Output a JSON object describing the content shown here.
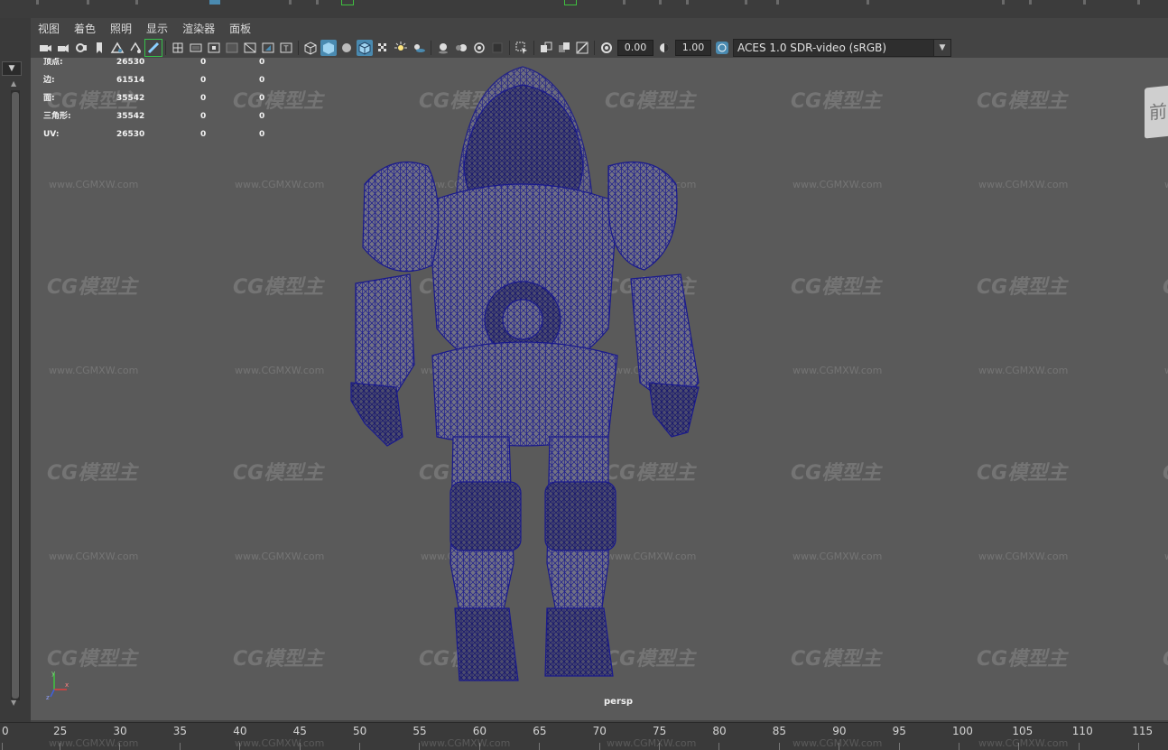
{
  "menu": [
    "视图",
    "着色",
    "照明",
    "显示",
    "渲染器",
    "面板"
  ],
  "toolbar": {
    "exposure": "0.00",
    "gamma": "1.00",
    "color_space": "ACES 1.0 SDR-video (sRGB)"
  },
  "hud": {
    "rows": [
      {
        "label": "顶点:",
        "v1": "26530",
        "v2": "0",
        "v3": "0"
      },
      {
        "label": "边:",
        "v1": "61514",
        "v2": "0",
        "v3": "0"
      },
      {
        "label": "面:",
        "v1": "35542",
        "v2": "0",
        "v3": "0"
      },
      {
        "label": "三角形:",
        "v1": "35542",
        "v2": "0",
        "v3": "0"
      },
      {
        "label": "UV:",
        "v1": "26530",
        "v2": "0",
        "v3": "0"
      }
    ]
  },
  "camera_label": "persp",
  "viewcube_face": "前",
  "axis_labels": {
    "y": "y",
    "x": "x",
    "z": "z"
  },
  "watermark": {
    "logo": "CG模型主",
    "url": "www.CGMXW.com"
  },
  "timeline": {
    "ticks": [
      "0",
      "25",
      "30",
      "35",
      "40",
      "45",
      "50",
      "55",
      "60",
      "65",
      "70",
      "75",
      "80",
      "85",
      "90",
      "95",
      "100",
      "105",
      "110",
      "115"
    ]
  },
  "colors": {
    "wireframe": "#1a1a8c",
    "viewport_bg": "#5a5a5a",
    "active_tool": "#4a8ab0"
  }
}
